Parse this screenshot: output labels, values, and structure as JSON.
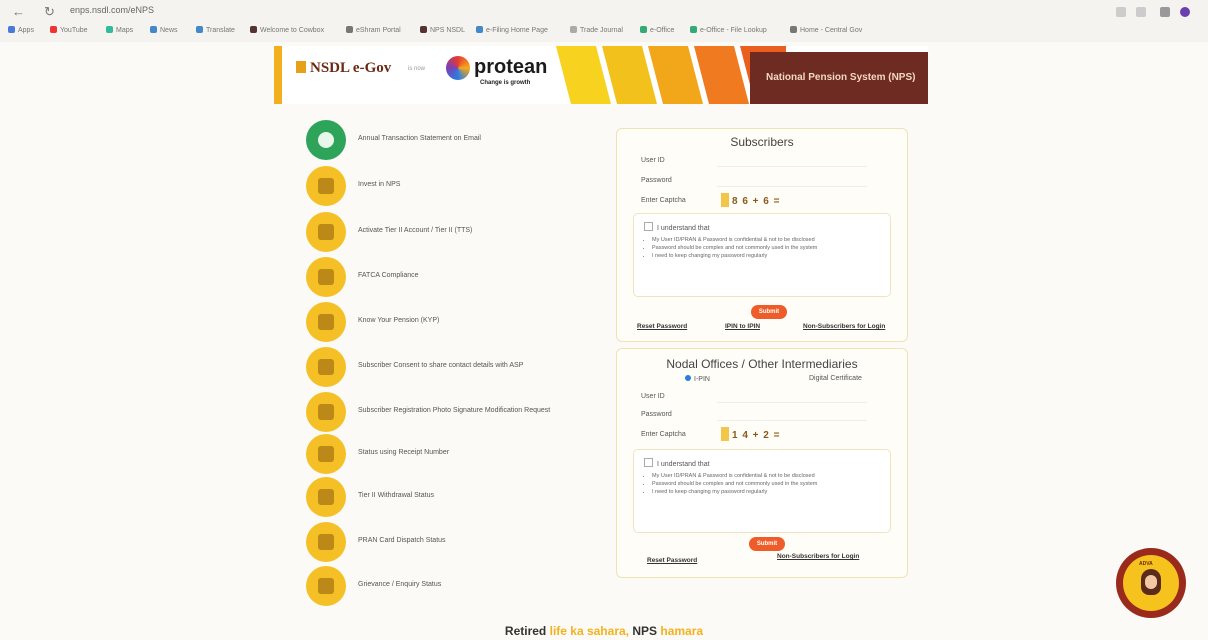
{
  "browser": {
    "url": "enps.nsdl.com/eNPS",
    "bookmarks": [
      "Apps",
      "YouTube",
      "Maps",
      "News",
      "Translate",
      "Welcome to Cowbox",
      "eShram Portal",
      "NPS NSDL",
      "e-Filing Home Page",
      "Trade Journal",
      "e-Office",
      "e-Office - File Lookup",
      "Home - Central Gov"
    ]
  },
  "header": {
    "nsdl_logo": "NSDL e-Gov",
    "now_is": "is now",
    "protean_logo": "protean",
    "tagline": "Change is growth",
    "banner_title": "National Pension System (NPS)",
    "colors": {
      "yellow": "#f2b01e",
      "orange": "#ef7a1f",
      "maroon": "#6d2b22"
    }
  },
  "menu": {
    "items": [
      {
        "label": "Annual Transaction Statement on Email",
        "icon": "leaf-icon"
      },
      {
        "label": "Invest in NPS",
        "icon": "building-icon"
      },
      {
        "label": "Activate Tier II Account / Tier II (TTS)",
        "icon": "power-icon"
      },
      {
        "label": "FATCA Compliance",
        "icon": "handshake-icon"
      },
      {
        "label": "Know Your Pension (KYP)",
        "icon": "document-icon"
      },
      {
        "label": "Subscriber Consent to share contact details with ASP",
        "icon": "id-card-icon"
      },
      {
        "label": "Subscriber Registration Photo Signature Modification Request",
        "icon": "users-icon"
      },
      {
        "label": "Status using Receipt Number",
        "icon": "gear-icon"
      },
      {
        "label": "Tier II Withdrawal Status",
        "icon": "chart-icon"
      },
      {
        "label": "PRAN Card Dispatch Status",
        "icon": "truck-icon"
      },
      {
        "label": "Grievance / Enquiry Status",
        "icon": "person-icon"
      }
    ]
  },
  "subscribers": {
    "title": "Subscribers",
    "user_id_label": "User ID",
    "password_label": "Password",
    "captcha_label": "Enter Captcha",
    "captcha": "8 6 + 6 =",
    "agree": "I understand that",
    "terms": [
      "My User ID/PRAN & Password is confidential & not to be disclosed",
      "Password should be complex and not commonly used in the system",
      "I need to keep changing my password regularly"
    ],
    "submit": "Submit",
    "links": [
      "Reset Password",
      "IPIN to IPIN",
      "Non-Subscribers for Login"
    ]
  },
  "nodal": {
    "title": "Nodal Offices / Other Intermediaries",
    "radio_ipin": "I-PIN",
    "radio_dsc": "Digital Certificate",
    "user_id_label": "User ID",
    "password_label": "Password",
    "captcha_label": "Enter Captcha",
    "captcha": "1 4 + 2 =",
    "agree": "I understand that",
    "terms": [
      "My User ID/PRAN & Password is confidential & not to be disclosed",
      "Password should be complex and not commonly used in the system",
      "I need to keep changing my password regularly"
    ],
    "submit": "Submit",
    "links": [
      "Reset Password",
      "Non-Subscribers for Login"
    ]
  },
  "footer": {
    "prefix": "Retired",
    "highlight1": "life ka sahara,",
    "middle": "NPS",
    "highlight2": "hamara"
  },
  "chatbot": {
    "tag": "ADVA"
  }
}
